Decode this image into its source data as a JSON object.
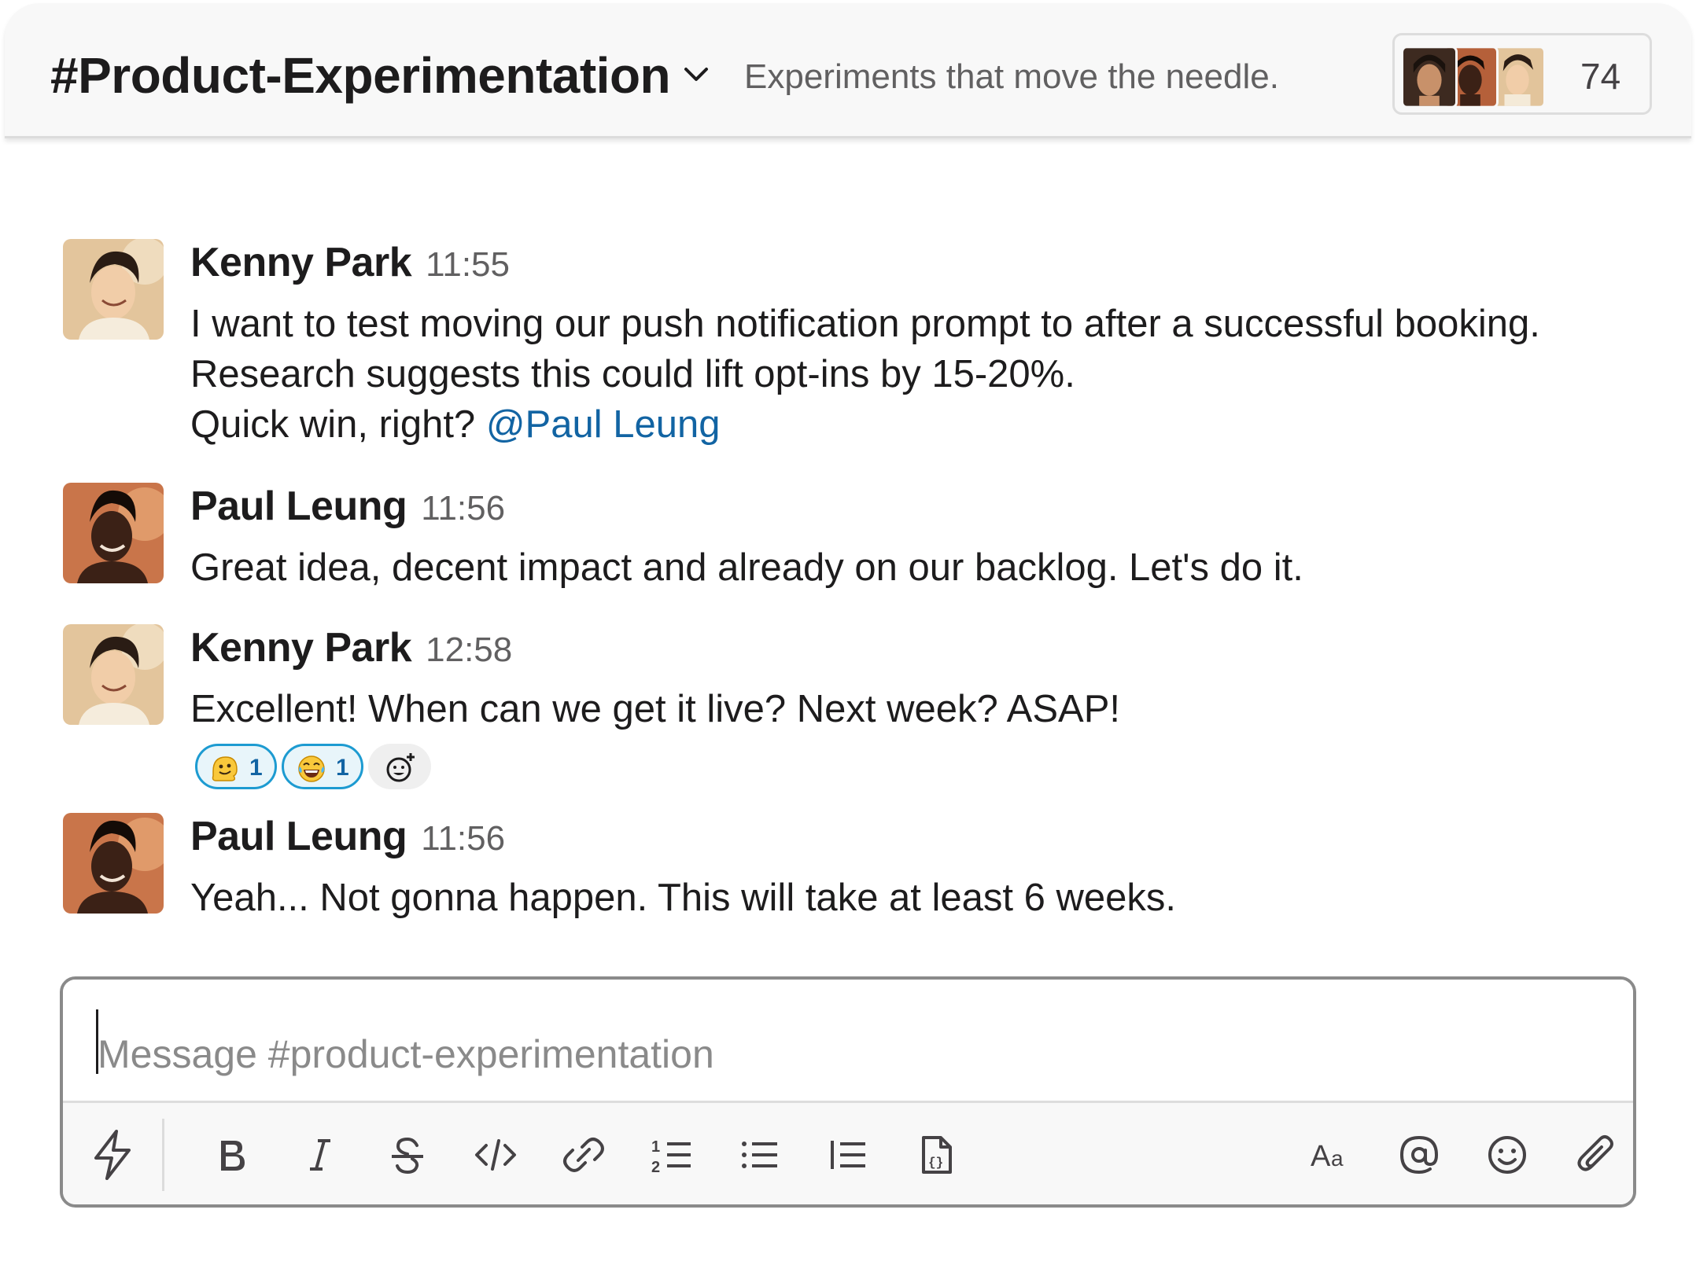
{
  "channel": {
    "name": "#Product-Experimentation",
    "topic": "Experiments that move the needle.",
    "member_count": "74"
  },
  "messages": [
    {
      "author": "Kenny Park",
      "time": "11:55",
      "lines": [
        "I want to test moving our push notification prompt to after a successful booking.",
        "Research suggests this could lift opt-ins by 15-20%.",
        "Quick win, right? "
      ],
      "mention": "@Paul Leung"
    },
    {
      "author": "Paul Leung",
      "time": "11:56",
      "lines": [
        "Great idea, decent impact and already on our backlog. Let's do it."
      ]
    },
    {
      "author": "Kenny Park",
      "time": "12:58",
      "lines": [
        "Excellent! When can we get it live? Next week? ASAP!"
      ],
      "reactions": [
        {
          "emoji": "melting-face",
          "count": "1"
        },
        {
          "emoji": "joy-face",
          "count": "1"
        }
      ]
    },
    {
      "author": "Paul Leung",
      "time": "11:56",
      "lines": [
        "Yeah... Not gonna happen. This will take at least 6 weeks."
      ]
    }
  ],
  "composer": {
    "placeholder": "Message #product-experimentation",
    "toolbar": [
      "lightning-icon",
      "bold-icon",
      "italic-icon",
      "strikethrough-icon",
      "code-icon",
      "link-icon",
      "ordered-list-icon",
      "bulleted-list-icon",
      "blockquote-icon",
      "code-block-icon",
      "formatting-icon",
      "mention-icon",
      "emoji-icon",
      "attachment-icon"
    ]
  },
  "colors": {
    "mention": "#1264a3",
    "reaction_border": "#1d9bd1",
    "reaction_bg": "#e8f5fa",
    "header_bg": "#f8f8f8"
  }
}
